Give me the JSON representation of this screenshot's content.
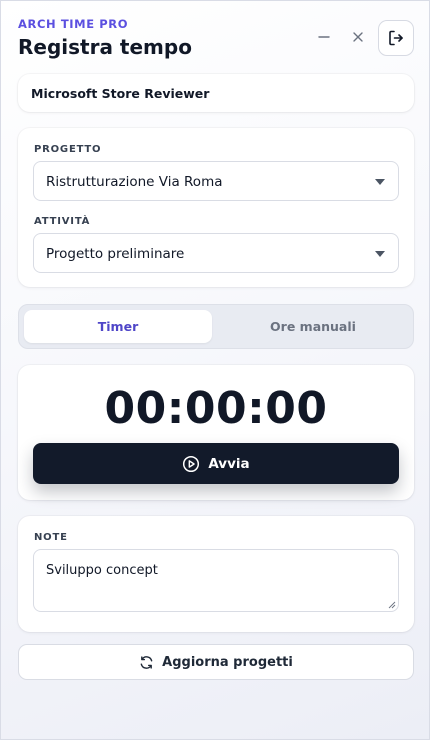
{
  "header": {
    "brand": "ARCH TIME PRO",
    "title": "Registra tempo",
    "minimize_icon": "minimize-icon",
    "close_icon": "close-icon",
    "logout_icon": "logout-icon"
  },
  "user": {
    "name": "Microsoft Store Reviewer"
  },
  "project": {
    "label": "PROGETTO",
    "value": "Ristrutturazione Via Roma"
  },
  "activity": {
    "label": "ATTIVITÀ",
    "value": "Progetto preliminare"
  },
  "tabs": [
    {
      "label": "Timer",
      "active": true
    },
    {
      "label": "Ore manuali",
      "active": false
    }
  ],
  "timer": {
    "display": "00:00:00",
    "start_label": "Avvia",
    "start_icon": "play-circle-icon"
  },
  "notes": {
    "label": "NOTE",
    "value": "Sviluppo concept"
  },
  "refresh": {
    "label": "Aggiorna progetti",
    "icon": "refresh-icon"
  },
  "colors": {
    "accent": "#5b4fe0",
    "tab_active": "#4f46c8",
    "primary_button": "#121a2a"
  }
}
